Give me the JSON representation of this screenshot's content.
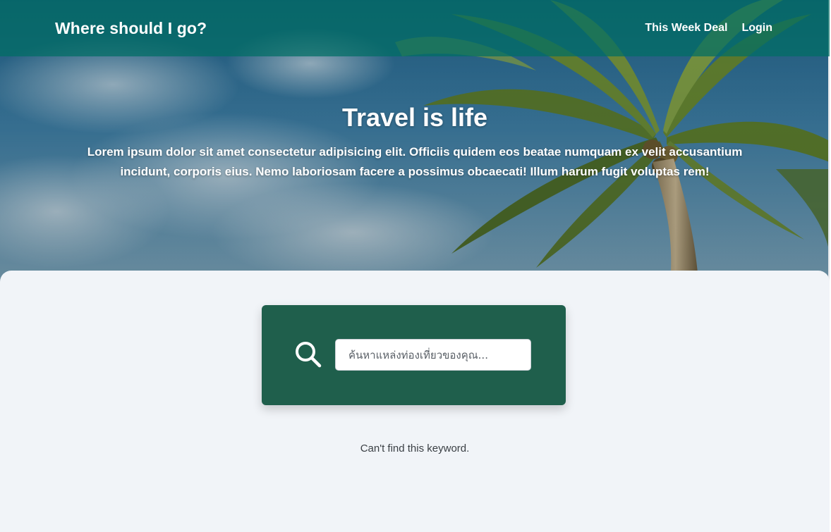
{
  "navbar": {
    "brand": "Where should I go?",
    "links": [
      {
        "label": "This Week Deal"
      },
      {
        "label": "Login"
      }
    ]
  },
  "hero": {
    "title": "Travel is life",
    "description": "Lorem ipsum dolor sit amet consectetur adipisicing elit. Officiis quidem eos beatae numquam ex velit accusantium incidunt, corporis eius. Nemo laboriosam facere a possimus obcaecati! Illum harum fugit voluptas rem!",
    "background": "palm-tree-beach-photo"
  },
  "search": {
    "icon": "search-icon",
    "placeholder": "ค้นหาแหล่งท่องเที่ยวของคุณ...",
    "value": ""
  },
  "results": {
    "empty_message": "Can't find this keyword."
  },
  "colors": {
    "navbar_bg": "#0b6e64",
    "search_card_bg": "#1f5f4c",
    "page_bg": "#f1f4f8",
    "text_light": "#ffffff"
  }
}
